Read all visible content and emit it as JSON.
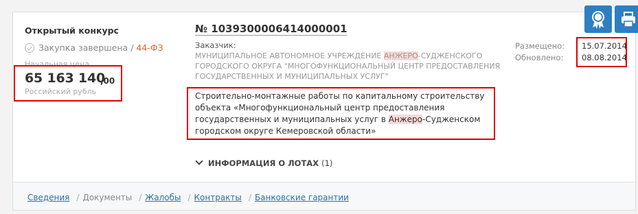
{
  "purchase": {
    "type": "Открытый конкурс",
    "status": "Закупка завершена",
    "status_sep": " / ",
    "law": "44-ФЗ",
    "price_label": "Начальная цена",
    "price_main": "65 163 140",
    "price_cents": ",00",
    "currency": "Российский рубль",
    "number": "№ 1039300006414000001",
    "customer_label": "Заказчик:",
    "customer_part1": "МУНИЦИПАЛЬНОЕ АВТОНОМНОЕ УЧРЕЖДЕНИЕ ",
    "customer_highlight": "АНЖЕРО",
    "customer_part2": "-СУДЖЕНСКОГО ГОРОДСКОГО ОКРУГА \"МНОГОФУНКЦИОНАЛЬНЫЙ ЦЕНТР ПРЕДОСТАВЛЕНИЯ ГОСУДАРСТВЕННЫХ И МУНИЦИПАЛЬНЫХ УСЛУГ\"",
    "subject_part1": "Строительно-монтажные работы по капитальному строительству объекта «Многофункциональный центр предоставления государственных и муниципальных услуг в ",
    "subject_highlight": "Анжеро",
    "subject_part2": "-Судженском городском округе Кемеровской области»",
    "lots_label": "ИНФОРМАЦИЯ О ЛОТАХ",
    "lots_count": "(1)",
    "placed_label": "Размещено:",
    "placed_date": "15.07.2014",
    "updated_label": "Обновлено:",
    "updated_date": "08.08.2014"
  },
  "tabs": [
    {
      "label": "Сведения"
    },
    {
      "label": "Документы"
    },
    {
      "label": "Жалобы"
    },
    {
      "label": "Контракты"
    },
    {
      "label": "Банковские гарантии"
    }
  ],
  "icons": {
    "seal": "award-seal-icon",
    "print": "printer-icon"
  },
  "colors": {
    "accent": "#2d7fc1",
    "law": "#d0693a",
    "highlight": "#f9d9d6",
    "annotation": "#e00000",
    "link": "#2c6fa5"
  }
}
